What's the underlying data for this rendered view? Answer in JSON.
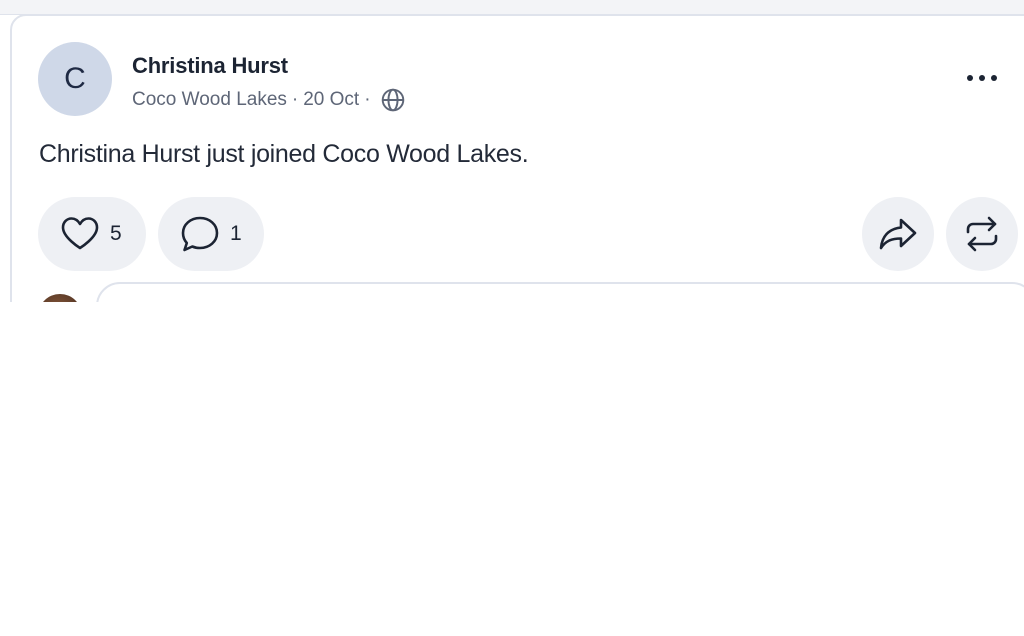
{
  "post": {
    "avatar_initial": "C",
    "author_name": "Christina Hurst",
    "community": "Coco Wood Lakes",
    "separator": "·",
    "date": "20 Oct",
    "visibility_icon": "globe-icon",
    "more_icon": "more-horizontal-icon",
    "body": "Christina Hurst just joined Coco Wood Lakes.",
    "actions": {
      "like_icon": "heart-icon",
      "like_count": "5",
      "comment_icon": "comment-bubble-icon",
      "comment_count": "1",
      "share_icon": "share-arrow-icon",
      "repost_icon": "repost-icon"
    },
    "comment_box": {
      "placeholder": ""
    }
  },
  "colors": {
    "avatar_bg": "#cfd8e8",
    "pill_bg": "#eef0f4",
    "border": "#dfe3ec",
    "text_primary": "#1c2433",
    "text_secondary": "#5e6677"
  }
}
